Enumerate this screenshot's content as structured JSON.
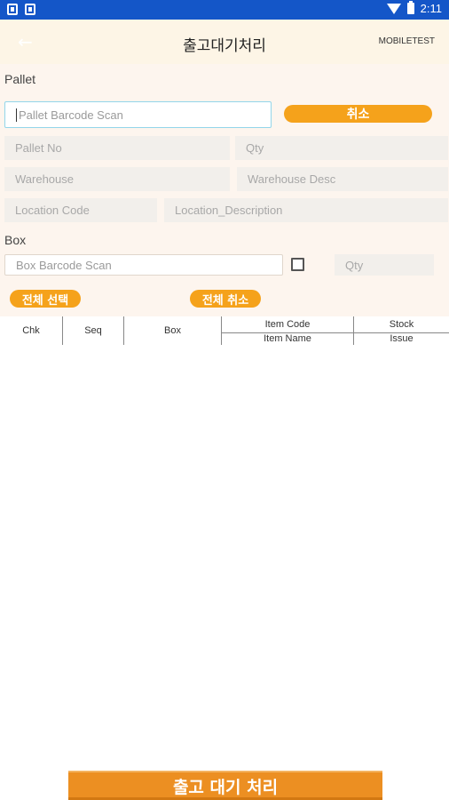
{
  "statusbar": {
    "time": "2:11",
    "icons": [
      "shield-icon",
      "sim-icon",
      "wifi-icon",
      "battery-icon"
    ]
  },
  "appbar": {
    "back_icon": "back-arrow-icon",
    "title": "출고대기처리",
    "user": "MOBILETEST"
  },
  "pallet": {
    "section_label": "Pallet",
    "scan_placeholder": "Pallet Barcode Scan",
    "cancel_label": "취소",
    "pallet_no": "Pallet No",
    "qty": "Qty",
    "warehouse": "Warehouse",
    "warehouse_desc": "Warehouse Desc",
    "location_code": "Location Code",
    "location_description": "Location_Description"
  },
  "box": {
    "section_label": "Box",
    "scan_placeholder": "Box Barcode Scan",
    "qty": "Qty"
  },
  "actions": {
    "select_all": "전체 선택",
    "cancel_all": "전체 취소"
  },
  "table": {
    "headers": {
      "chk": "Chk",
      "seq": "Seq",
      "box": "Box",
      "item_code": "Item Code",
      "item_name": "Item Name",
      "stock": "Stock",
      "issue": "Issue"
    }
  },
  "footer": {
    "submit_label": "출고 대기 처리"
  },
  "colors": {
    "status_bar": "#1456c8",
    "accent": "#f5a21b",
    "header_bg": "#fdf5e6"
  }
}
